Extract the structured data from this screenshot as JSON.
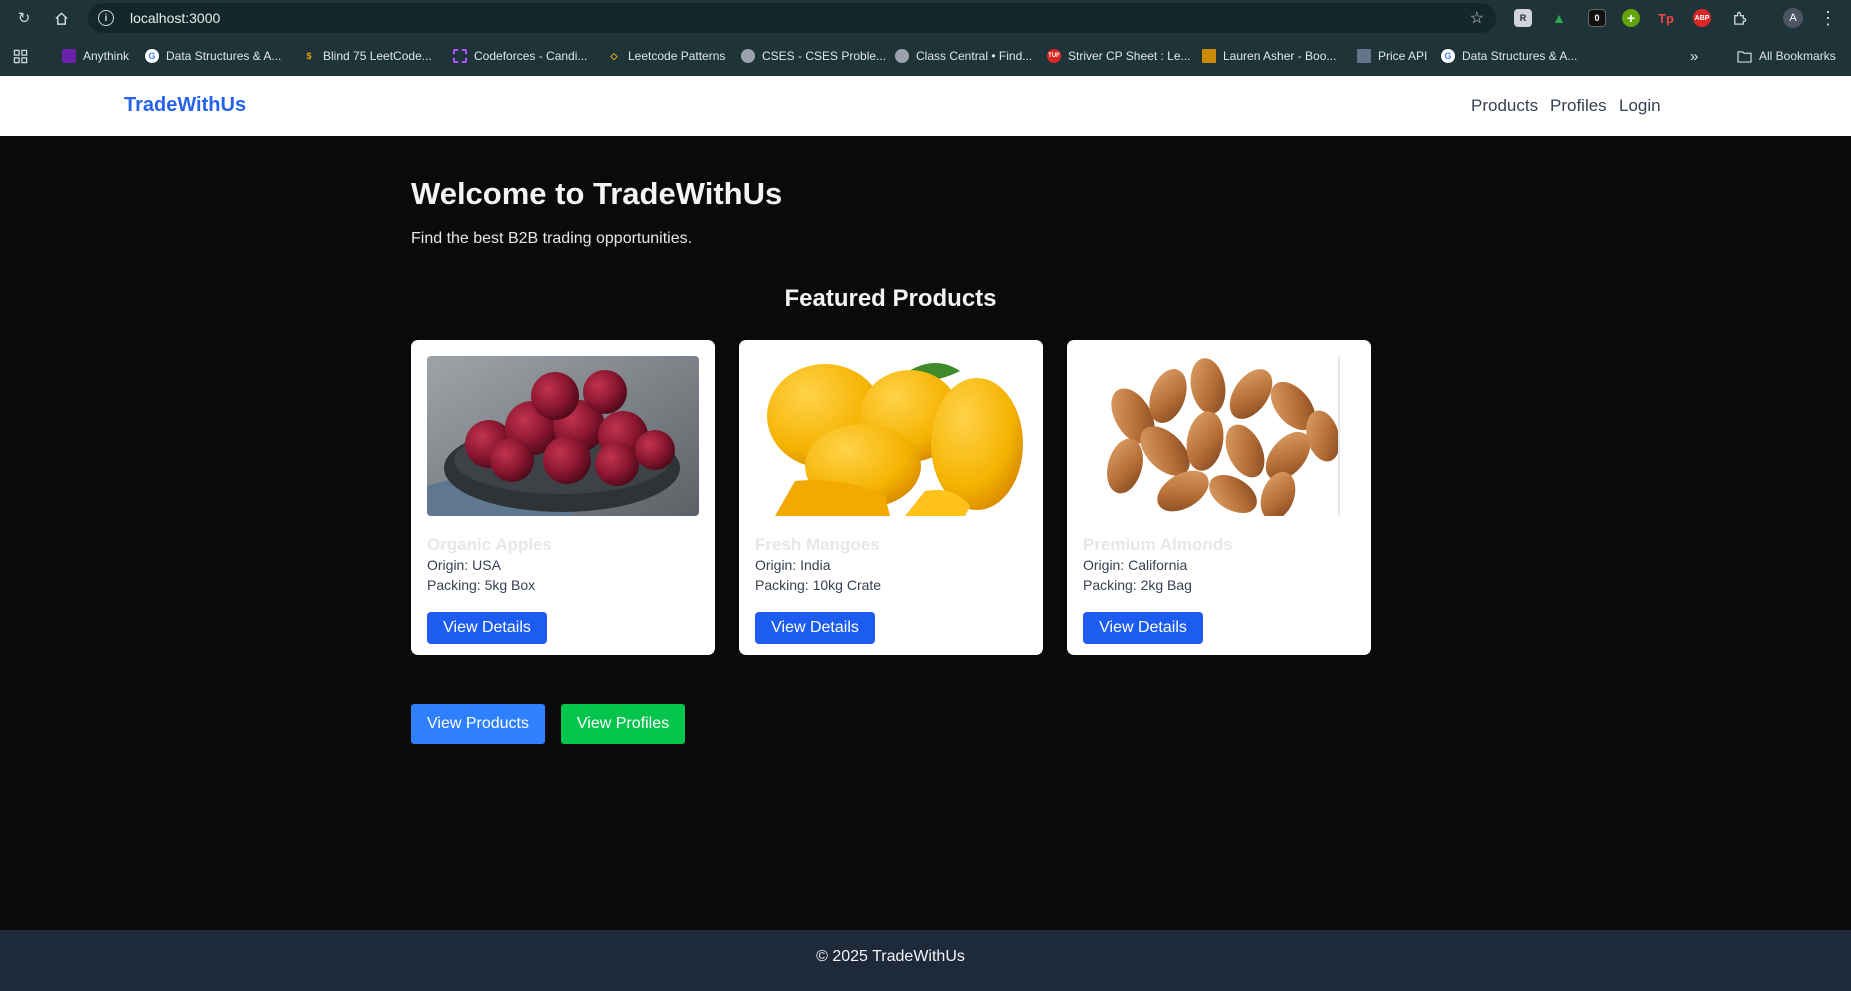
{
  "browser": {
    "url": "localhost:3000",
    "bookmarks": [
      {
        "label": "Anythink",
        "color": "#6b21a8"
      },
      {
        "label": "Data Structures & A...",
        "color": "#4285f4"
      },
      {
        "label": "Blind 75 LeetCode...",
        "color": "#f59e0b"
      },
      {
        "label": "Codeforces - Candi...",
        "color": "#a855f7"
      },
      {
        "label": "Leetcode Patterns",
        "color": "#eab308"
      },
      {
        "label": "CSES - CSES Proble...",
        "color": "#9ca3af"
      },
      {
        "label": "Class Central • Find...",
        "color": "#9ca3af"
      },
      {
        "label": "Striver CP Sheet : Le...",
        "color": "#dc2626"
      },
      {
        "label": "Lauren Asher - Boo...",
        "color": "#ca8a04"
      },
      {
        "label": "Price API",
        "color": "#64748b"
      },
      {
        "label": "Data Structures & A...",
        "color": "#4285f4"
      }
    ],
    "all_bookmarks": "All Bookmarks",
    "extensions": [
      "R",
      "▲",
      "0",
      "+",
      "Tp",
      "ABP"
    ],
    "profile_initial": "A"
  },
  "site": {
    "brand": "TradeWithUs",
    "nav": [
      "Products",
      "Profiles",
      "Login"
    ]
  },
  "hero": {
    "title": "Welcome to TradeWithUs",
    "tagline": "Find the best B2B trading opportunities."
  },
  "featured": {
    "heading": "Featured Products",
    "products": [
      {
        "name": "Organic Apples",
        "origin": "Origin: USA",
        "packing": "Packing: 5kg Box",
        "button": "View Details"
      },
      {
        "name": "Fresh Mangoes",
        "origin": "Origin: India",
        "packing": "Packing: 10kg Crate",
        "button": "View Details"
      },
      {
        "name": "Premium Almonds",
        "origin": "Origin: California",
        "packing": "Packing: 2kg Bag",
        "button": "View Details"
      }
    ]
  },
  "cta": {
    "products": "View Products",
    "profiles": "View Profiles",
    "products_color": "#2f80ff",
    "profiles_color": "#05c44c"
  },
  "footer": {
    "text": "© 2025 TradeWithUs"
  }
}
